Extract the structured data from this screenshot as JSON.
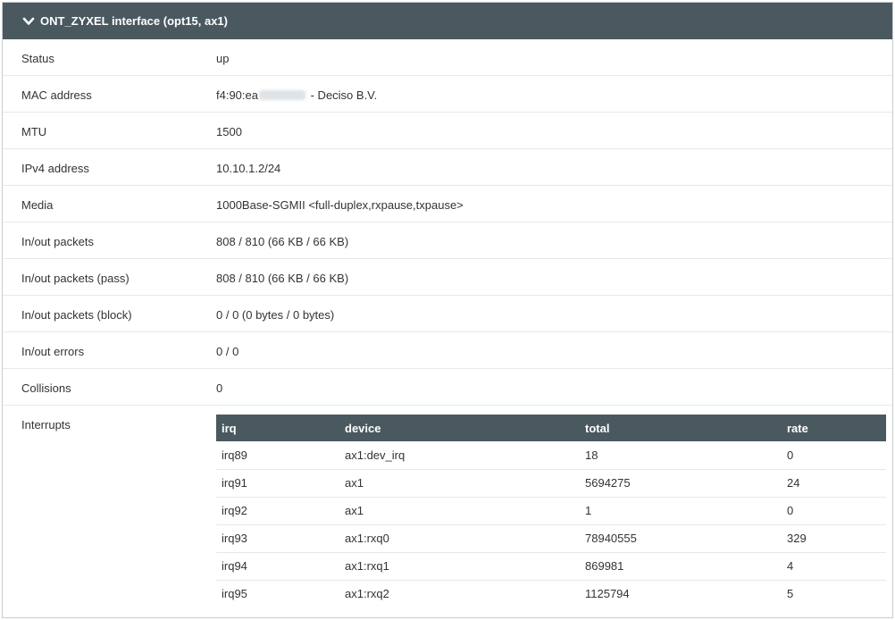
{
  "panel": {
    "title": "ONT_ZYXEL interface (opt15, ax1)",
    "header_bg": "#4a5960",
    "toggle_icon": "chevron-down-icon"
  },
  "rows": {
    "status": {
      "label": "Status",
      "value": "up"
    },
    "mac": {
      "label": "MAC address",
      "value_prefix": "f4:90:ea",
      "value_suffix": " - Deciso B.V."
    },
    "mtu": {
      "label": "MTU",
      "value": "1500"
    },
    "ipv4": {
      "label": "IPv4 address",
      "value": "10.10.1.2/24"
    },
    "media": {
      "label": "Media",
      "value": "1000Base-SGMII <full-duplex,rxpause,txpause>"
    },
    "packets": {
      "label": "In/out packets",
      "value": "808 / 810 (66 KB / 66 KB)"
    },
    "packets_pass": {
      "label": "In/out packets (pass)",
      "value": "808 / 810 (66 KB / 66 KB)"
    },
    "packets_block": {
      "label": "In/out packets (block)",
      "value": "0 / 0 (0 bytes / 0 bytes)"
    },
    "errors": {
      "label": "In/out errors",
      "value": "0 / 0"
    },
    "collisions": {
      "label": "Collisions",
      "value": "0"
    },
    "interrupts": {
      "label": "Interrupts"
    }
  },
  "interrupts_table": {
    "headers": [
      "irq",
      "device",
      "total",
      "rate"
    ],
    "rows": [
      [
        "irq89",
        "ax1:dev_irq",
        "18",
        "0"
      ],
      [
        "irq91",
        "ax1",
        "5694275",
        "24"
      ],
      [
        "irq92",
        "ax1",
        "1",
        "0"
      ],
      [
        "irq93",
        "ax1:rxq0",
        "78940555",
        "329"
      ],
      [
        "irq94",
        "ax1:rxq1",
        "869981",
        "4"
      ],
      [
        "irq95",
        "ax1:rxq2",
        "1125794",
        "5"
      ]
    ]
  }
}
